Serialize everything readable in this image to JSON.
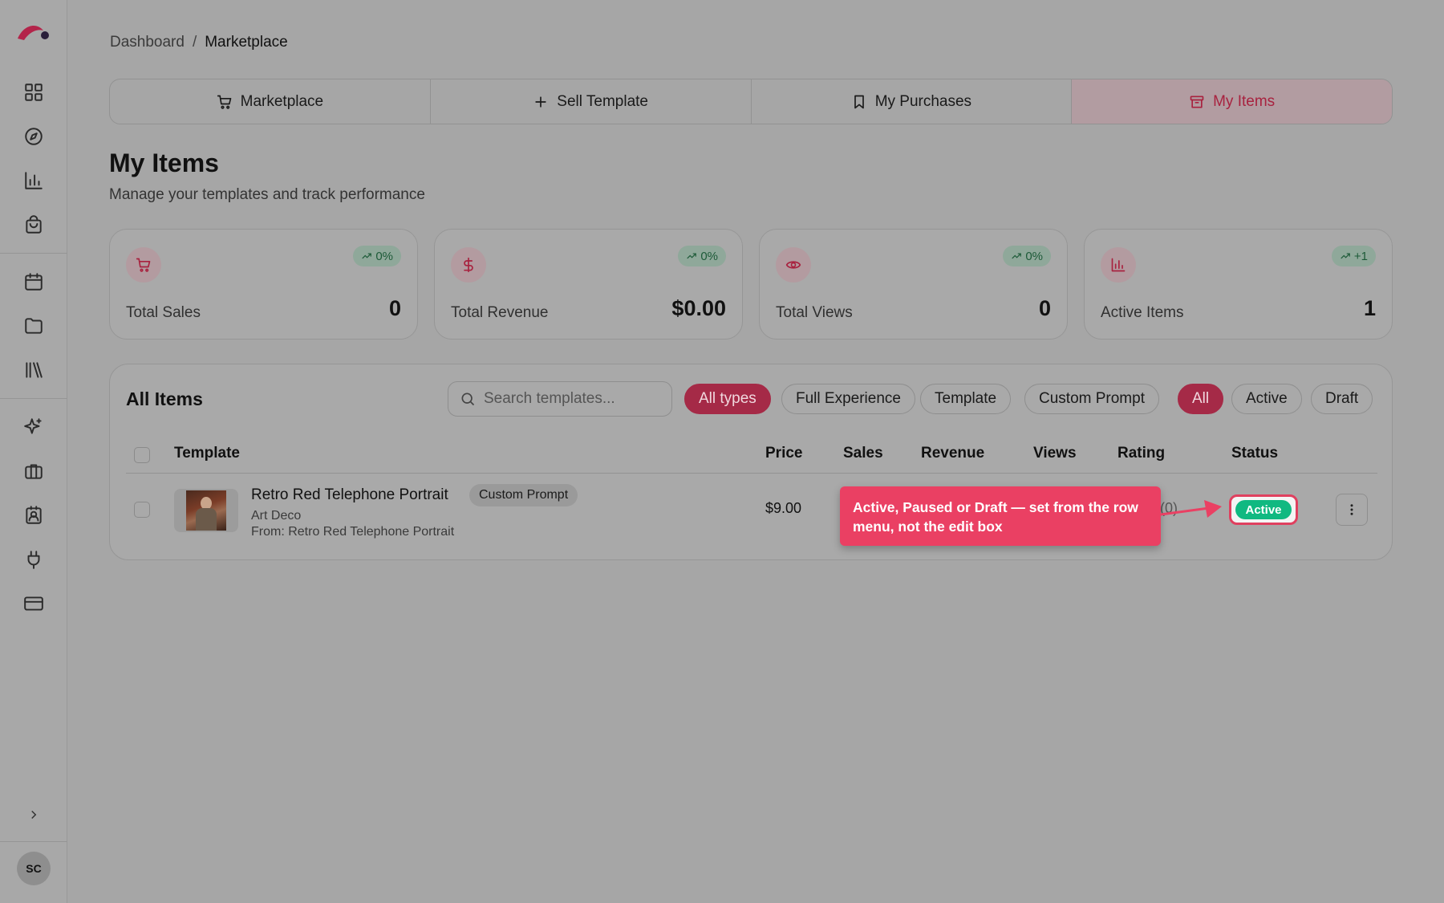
{
  "breadcrumb": {
    "root": "Dashboard",
    "separator": "/",
    "current": "Marketplace"
  },
  "tabs": [
    {
      "label": "Marketplace",
      "icon": "cart-icon"
    },
    {
      "label": "Sell Template",
      "icon": "plus-icon"
    },
    {
      "label": "My Purchases",
      "icon": "bookmark-icon"
    },
    {
      "label": "My Items",
      "icon": "archive-icon",
      "active": true
    }
  ],
  "header": {
    "title": "My Items",
    "subtitle": "Manage your templates and track performance"
  },
  "stats": [
    {
      "label": "Total Sales",
      "value": "0",
      "change": "0%",
      "icon": "cart-icon"
    },
    {
      "label": "Total Revenue",
      "value": "$0.00",
      "change": "0%",
      "icon": "dollar-icon"
    },
    {
      "label": "Total Views",
      "value": "0",
      "change": "0%",
      "icon": "eye-icon"
    },
    {
      "label": "Active Items",
      "value": "1",
      "change": "+1",
      "icon": "bar-chart-icon"
    }
  ],
  "items": {
    "title": "All Items",
    "search_placeholder": "Search templates...",
    "type_filters": [
      "All types",
      "Full Experience",
      "Template",
      "Custom Prompt"
    ],
    "status_filters": [
      "All",
      "Active",
      "Draft"
    ],
    "columns": [
      "Template",
      "Price",
      "Sales",
      "Revenue",
      "Views",
      "Rating",
      "Status"
    ],
    "rows": [
      {
        "name": "Retro Red Telephone Portrait",
        "tag": "Custom Prompt",
        "category": "Art Deco",
        "from": "From: Retro Red Telephone Portrait",
        "price": "$9.00",
        "rating": "(0)",
        "status": "Active"
      }
    ]
  },
  "callout": {
    "text": "Active, Paused or Draft — set from the row menu, not the edit box"
  },
  "user": {
    "initials": "SC"
  },
  "colors": {
    "accent": "#a52a47",
    "callout": "#ea4063",
    "status_active": "#10b981"
  }
}
